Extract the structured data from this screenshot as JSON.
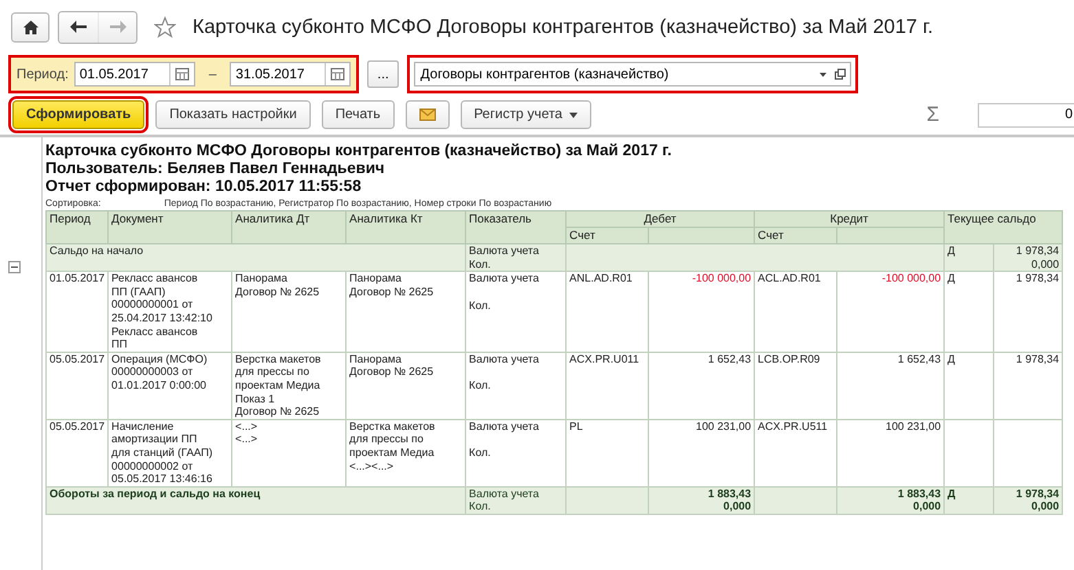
{
  "nav": {
    "forward_disabled": true
  },
  "title": "Карточка субконто МСФО Договоры контрагентов (казначейство) за Май 2017 г.",
  "period": {
    "label": "Период:",
    "from": "01.05.2017",
    "dash": "–",
    "to": "31.05.2017",
    "more": "..."
  },
  "subconto": {
    "value": "Договоры контрагентов (казначейство)"
  },
  "actions": [
    {
      "kind": "primary",
      "label": "Сформировать"
    },
    {
      "kind": "button",
      "label": "Показать настройки"
    },
    {
      "kind": "button",
      "label": "Печать"
    },
    {
      "kind": "mail"
    },
    {
      "kind": "dropdown",
      "label": "Регистр учета"
    }
  ],
  "sum": {
    "symbol": "Σ",
    "value": "0"
  },
  "report": {
    "title": "Карточка субконто МСФО Договоры контрагентов (казначейство) за Май 2017 г.",
    "user": "Пользователь: Беляев Павел Геннадьевич",
    "generated": "Отчет сформирован: 10.05.2017 11:55:58",
    "sort_label": "Сортировка:",
    "sort_value": "Период По возрастанию, Регистратор По возрастанию, Номер строки По возрастанию"
  },
  "table": {
    "columns": [
      "Период",
      "Документ",
      "Аналитика Дт",
      "Аналитика Кт",
      "Показатель"
    ],
    "debit": "Дебет",
    "credit": "Кредит",
    "debit_account": "Счет",
    "credit_account": "Счет",
    "balance": "Текущее сальдо",
    "rows": [
      {
        "kind": "group",
        "label": "Сальдо на начало",
        "indicator": [
          "Валюта учета",
          "Кол."
        ],
        "side": "Д",
        "balance": [
          "1 978,34",
          "0,000"
        ]
      },
      {
        "kind": "entry",
        "period": "01.05.2017",
        "document": [
          "Рекласс авансов",
          "ПП (ГААП)",
          "00000000001 от",
          "25.04.2017 13:42:10",
          "Рекласс авансов",
          "ПП"
        ],
        "analytics_dt": [
          "Панорама",
          "Договор № 2625"
        ],
        "analytics_kt": [
          "Панорама",
          "Договор № 2625"
        ],
        "indicator": [
          "Валюта учета",
          "Кол."
        ],
        "debit_account": "ANL.AD.R01",
        "debit_amount": "-100 000,00",
        "debit_negative": true,
        "credit_account": "ACL.AD.R01",
        "credit_amount": "-100 000,00",
        "credit_negative": true,
        "side": "Д",
        "balance": [
          "1 978,34"
        ]
      },
      {
        "kind": "entry",
        "period": "05.05.2017",
        "document": [
          "Операция (МСФО)",
          "00000000003 от",
          "01.01.2017 0:00:00"
        ],
        "analytics_dt": [
          "Верстка макетов",
          "для прессы по",
          "проектам Медиа",
          "Показ 1",
          "Договор № 2625"
        ],
        "analytics_kt": [
          "Панорама",
          "Договор № 2625"
        ],
        "indicator": [
          "Валюта учета",
          "Кол."
        ],
        "debit_account": "ACX.PR.U011",
        "debit_amount": "1 652,43",
        "debit_negative": false,
        "credit_account": "LCB.OP.R09",
        "credit_amount": "1 652,43",
        "credit_negative": false,
        "side": "Д",
        "balance": [
          "1 978,34"
        ]
      },
      {
        "kind": "entry",
        "period": "05.05.2017",
        "document": [
          "Начисление",
          "амортизации ПП",
          "для станций (ГААП)",
          "00000000002 от",
          "05.05.2017 13:46:16"
        ],
        "analytics_dt": [
          "<...>",
          "<...>"
        ],
        "analytics_kt": [
          "Верстка макетов",
          "для прессы по",
          "проектам Медиа",
          "<...><...>"
        ],
        "indicator": [
          "Валюта учета",
          "Кол."
        ],
        "debit_account": "PL",
        "debit_amount": "100 231,00",
        "debit_negative": false,
        "credit_account": "ACX.PR.U511",
        "credit_amount": "100 231,00",
        "credit_negative": false
      },
      {
        "kind": "total",
        "label": "Обороты за период и сальдо на конец",
        "indicator": [
          "Валюта учета",
          "Кол."
        ],
        "debit_amount": [
          "1 883,43",
          "0,000"
        ],
        "credit_amount": [
          "1 883,43",
          "0,000"
        ],
        "side": "Д",
        "balance": [
          "1 978,34",
          "0,000"
        ]
      }
    ]
  }
}
